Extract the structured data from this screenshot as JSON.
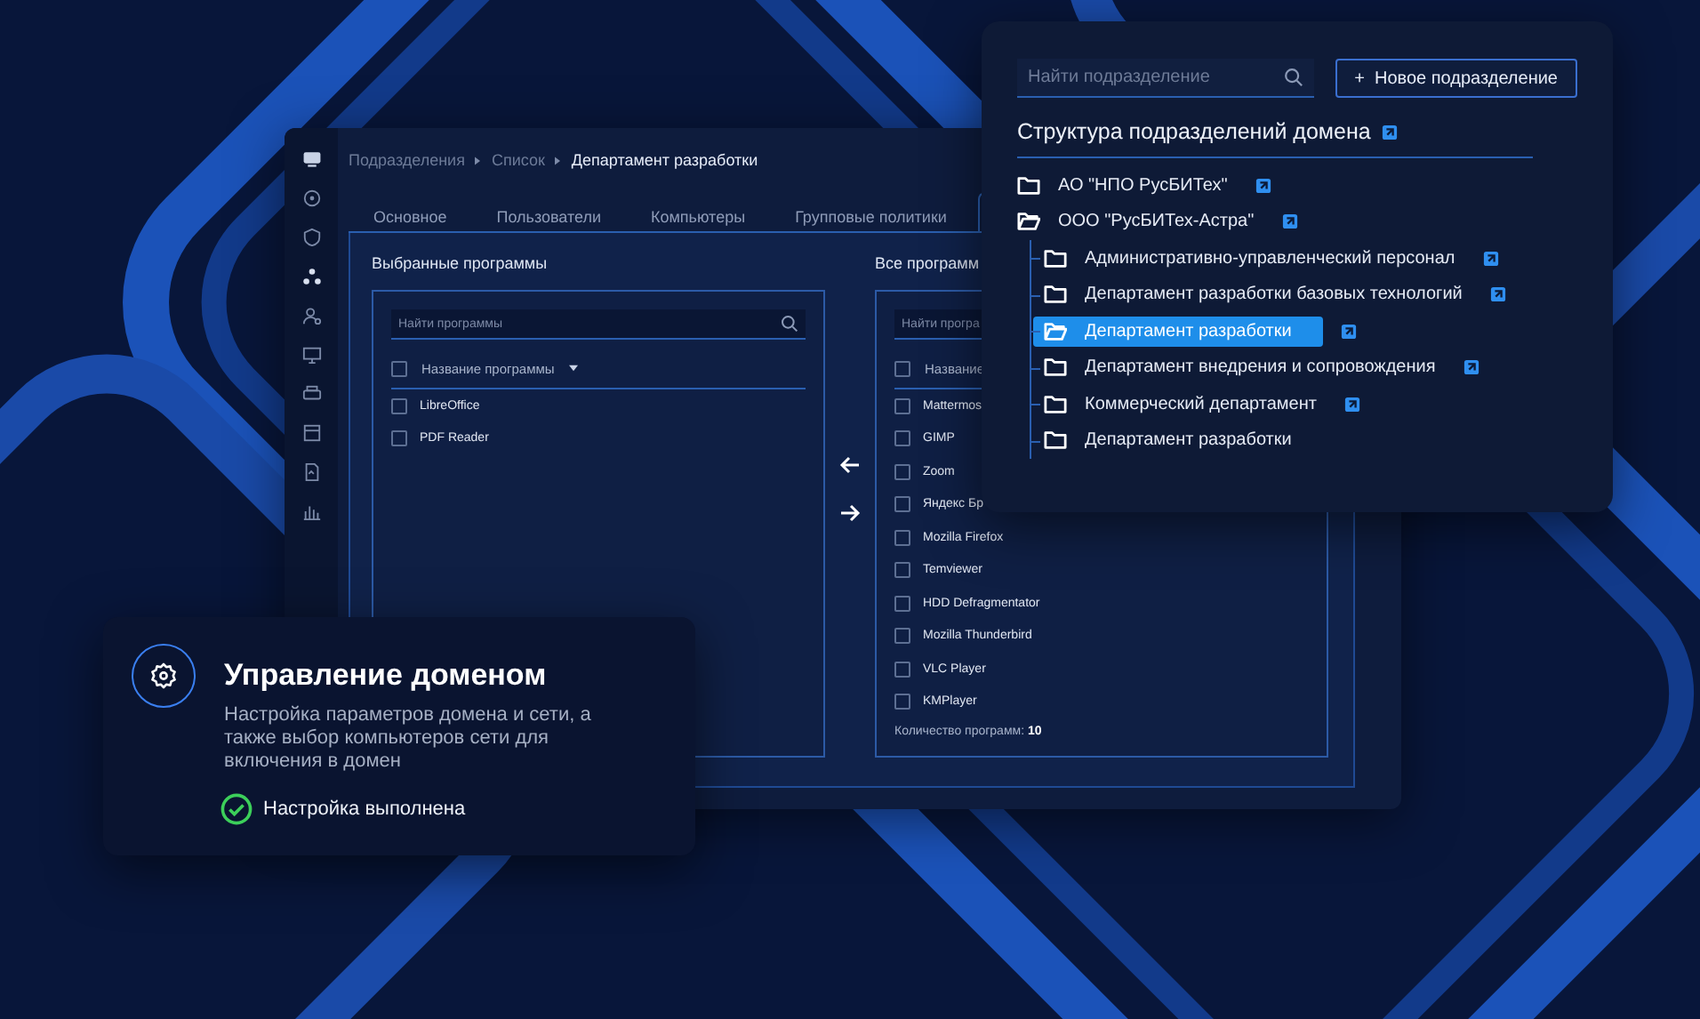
{
  "app": {
    "breadcrumb": [
      {
        "label": "Подразделения",
        "current": false
      },
      {
        "label": "Список",
        "current": false
      },
      {
        "label": "Департамент разработки",
        "current": true
      }
    ],
    "tabs": [
      {
        "label": "Основное",
        "selected": false
      },
      {
        "label": "Пользователи",
        "selected": false
      },
      {
        "label": "Компьютеры",
        "selected": false
      },
      {
        "label": "Групповые политики",
        "selected": false
      }
    ],
    "selected_programs": {
      "title": "Выбранные программы",
      "search": {
        "placeholder": "Найти программы"
      },
      "header": "Название программы",
      "all_checked": false,
      "items": [
        {
          "name": "LibreOffice",
          "checked": false
        },
        {
          "name": "PDF Reader",
          "checked": false
        }
      ]
    },
    "all_programs": {
      "title": "Все программ",
      "search": {
        "placeholder": "Найти програ"
      },
      "header": "Название",
      "all_checked": false,
      "items": [
        {
          "name": "Mattermos",
          "checked": false
        },
        {
          "name": "GIMP",
          "checked": false
        },
        {
          "name": "Zoom",
          "checked": false
        },
        {
          "name": "Яндекс Бр",
          "checked": false
        },
        {
          "name": "Mozilla Firefox",
          "checked": false
        },
        {
          "name": "Temviewer",
          "checked": false
        },
        {
          "name": "HDD Defragmentator",
          "checked": false
        },
        {
          "name": "Mozilla Thunderbird",
          "checked": false
        },
        {
          "name": "VLC Player",
          "checked": false
        },
        {
          "name": "KMPlayer",
          "checked": false
        }
      ],
      "count_label": "Количество программ:",
      "count": "10"
    }
  },
  "tree_card": {
    "search": {
      "placeholder": "Найти подразделение"
    },
    "new_button": {
      "icon": "+",
      "label": "Новое подразделение"
    },
    "title": "Структура подразделений домена",
    "nodes": [
      {
        "name": "АО \"НПО РусБИТех\"",
        "expanded": false,
        "selected": false
      },
      {
        "name": "ООО \"РусБИТех-Астра\"",
        "expanded": true,
        "selected": false,
        "children": [
          {
            "name": "Административно-управленческий персонал",
            "expanded": false,
            "selected": false
          },
          {
            "name": "Департамент разработки базовых технологий",
            "expanded": false,
            "selected": false
          },
          {
            "name": "Департамент разработки",
            "expanded": true,
            "selected": true
          },
          {
            "name": "Департамент внедрения и сопровождения",
            "expanded": false,
            "selected": false
          },
          {
            "name": "Коммерческий департамент",
            "expanded": false,
            "selected": false
          },
          {
            "name": "Департамент разработки",
            "expanded": false,
            "selected": false,
            "link": false
          }
        ]
      }
    ]
  },
  "domain_card": {
    "title": "Управление доменом",
    "description": "Настройка параметров домена и сети, а также выбор компьютеров сети для включения в домен",
    "status": {
      "text": "Настройка выполнена",
      "done": true
    }
  }
}
